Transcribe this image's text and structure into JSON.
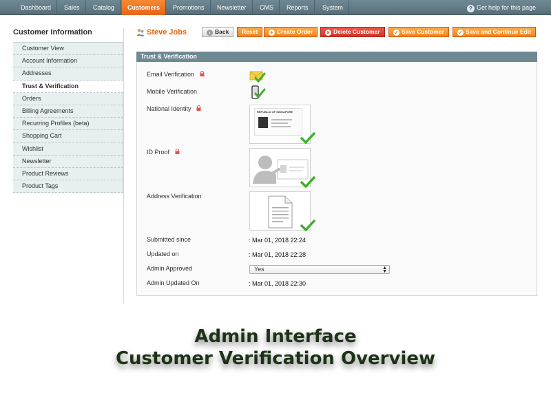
{
  "nav": {
    "items": [
      "Dashboard",
      "Sales",
      "Catalog",
      "Customers",
      "Promotions",
      "Newsletter",
      "CMS",
      "Reports",
      "System"
    ],
    "active_index": 3,
    "help_text": "Get help for this page"
  },
  "sidebar": {
    "title": "Customer Information",
    "items": [
      "Customer View",
      "Account Information",
      "Addresses",
      "Trust & Verification",
      "Orders",
      "Billing Agreements",
      "Recurring Profiles (beta)",
      "Shopping Cart",
      "Wishlist",
      "Newsletter",
      "Product Reviews",
      "Product Tags"
    ],
    "active_index": 3
  },
  "header": {
    "customer_name": "Steve Jobs",
    "buttons": {
      "back": "Back",
      "reset": "Reset",
      "create_order": "Create Order",
      "delete_customer": "Delete Customer",
      "save_customer": "Save Customer",
      "save_continue": "Save and Continue Edit"
    }
  },
  "panel": {
    "title": "Trust & Verification",
    "email_verification": "Email Verification",
    "mobile_verification": "Mobile Verification",
    "national_identity": "National Identity",
    "id_proof": "ID Proof",
    "address_verification": "Address Verification",
    "id_card_header": "REPUBLIC OF SINGAPORE",
    "submitted_since_label": "Submitted since",
    "submitted_since_value": ": Mar 01, 2018 22:24",
    "updated_on_label": "Updated on",
    "updated_on_value": ": Mar 01, 2018 22:28",
    "admin_approved_label": "Admin Approved",
    "admin_approved_value": "Yes",
    "admin_updated_label": "Admin Updated On",
    "admin_updated_value": ": Mar 01, 2018 22:30"
  },
  "caption": {
    "line1": "Admin Interface",
    "line2": "Customer Verification Overview"
  },
  "colors": {
    "accent": "#eb5e00",
    "nav_bg": "#6f8994",
    "check_green": "#3fae29"
  }
}
